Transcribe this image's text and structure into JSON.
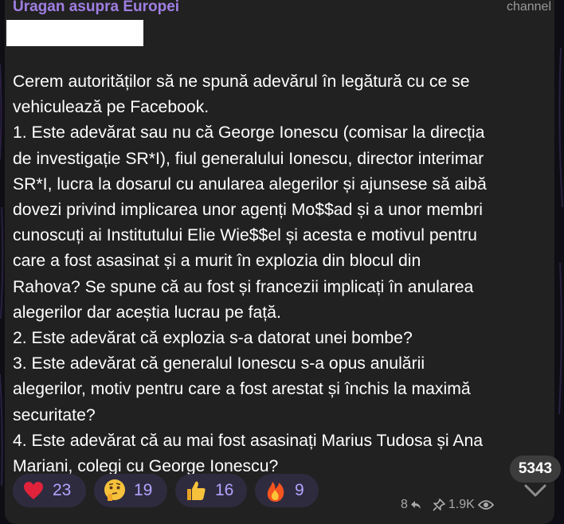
{
  "post": {
    "channel_name": "Uragan asupra Europei",
    "channel_tag": "channel",
    "lines": [
      "Cerem autorităților să ne spună adevărul în legătură cu ce se",
      "vehiculează pe Facebook.",
      "1. Este adevărat sau nu că George Ionescu (comisar la direcția",
      "de investigație SR*I), fiul generalului Ionescu, director interimar",
      "SR*I, lucra la dosarul cu anularea alegerilor și ajunsese să aibă",
      "dovezi privind implicarea unor agenți Mo$$ad și a unor membri",
      "cunoscuți ai Institutului Elie Wie$$el și acesta e motivul pentru",
      "care a fost asasinat și a murit în explozia din blocul din",
      "Rahova? Se spune că au fost și francezii implicați în anularea",
      "alegerilor dar aceștia lucrau pe față.",
      "2. Este adevărat că explozia s-a datorat unei bombe?",
      "3. Este adevărat că generalul Ionescu s-a opus anulării",
      "alegerilor, motiv pentru care a fost arestat și închis la maximă",
      "securitate?",
      "4. Este adevărat că au mai fost asasinați Marius Tudosa și Ana",
      "Mariani, colegi cu George Ionescu?"
    ]
  },
  "reactions": [
    {
      "icon": "red-heart-icon",
      "count": "23"
    },
    {
      "icon": "thinking-face-icon",
      "count": "19"
    },
    {
      "icon": "thumbs-up-icon",
      "count": "16"
    },
    {
      "icon": "fire-icon",
      "count": "9"
    }
  ],
  "meta": {
    "replies": "8",
    "views": "1.9K",
    "reply_icon": "reply-arrow-icon",
    "pin_icon": "pin-icon",
    "views_icon": "eye-icon"
  },
  "badge": {
    "unread_count": "5343"
  },
  "colors": {
    "bubble": "#212121",
    "channel_name": "#9f7fe3",
    "reaction_bg": "#2f2b3f",
    "reaction_count": "#b3a3ff"
  }
}
